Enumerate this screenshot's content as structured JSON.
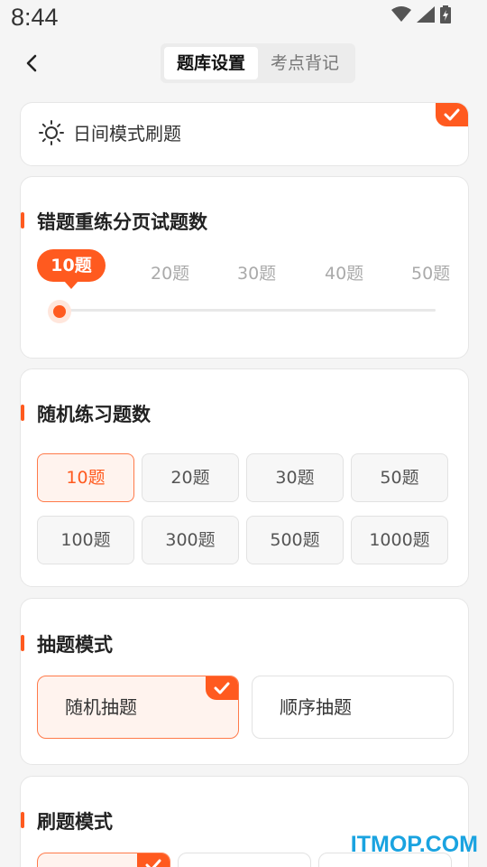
{
  "status": {
    "time": "8:44"
  },
  "nav": {
    "tabs": [
      "题库设置",
      "考点背记"
    ]
  },
  "day_mode": {
    "label": "日间模式刷题"
  },
  "wrong_page": {
    "title": "错题重练分页试题数",
    "selected": "10题",
    "ticks": [
      "20题",
      "30题",
      "40题",
      "50题"
    ]
  },
  "random_count": {
    "title": "随机练习题数",
    "options": [
      "10题",
      "20题",
      "30题",
      "50题",
      "100题",
      "300题",
      "500题",
      "1000题"
    ]
  },
  "draw_mode": {
    "title": "抽题模式",
    "options": [
      "随机抽题",
      "顺序抽题"
    ]
  },
  "practice_mode": {
    "title": "刷题模式"
  },
  "watermark": "ITMOP.COM",
  "colors": {
    "accent": "#ff5a1f",
    "background": "#f5f5f5"
  }
}
